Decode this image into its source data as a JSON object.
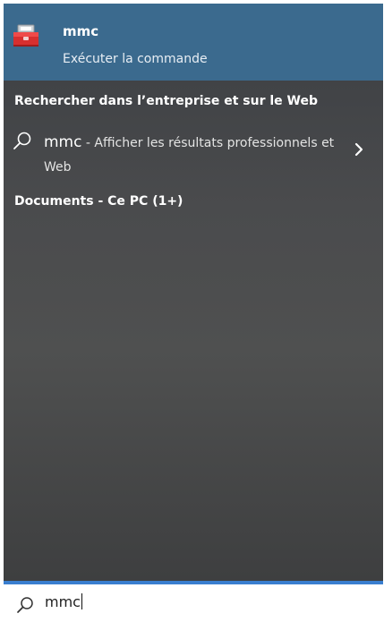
{
  "best_match": {
    "app_name": "mmc",
    "subtitle": "Exécuter la commande",
    "icon": "toolbox-icon"
  },
  "web": {
    "heading": "Rechercher dans l’entreprise et sur le Web",
    "query": "mmc",
    "result_text": " - Afficher les résultats professionnels et Web",
    "icon": "search-icon",
    "arrow_icon": "chevron-right-icon"
  },
  "documents": {
    "heading": "Documents - Ce PC (1+)"
  },
  "searchbox": {
    "value": "mmc",
    "icon": "search-icon"
  },
  "colors": {
    "selection": "#3b6a8e",
    "accent_line": "#3a7ecf"
  }
}
